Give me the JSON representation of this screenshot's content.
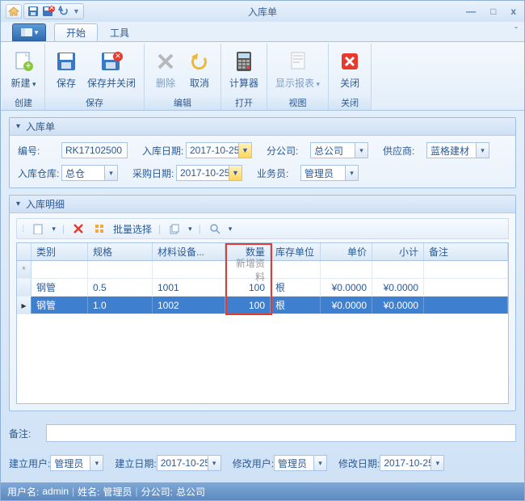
{
  "window": {
    "title": "入库单"
  },
  "ribbon_tabs": {
    "start": "开始",
    "tools": "工具"
  },
  "ribbon": {
    "new": "新建",
    "save": "保存",
    "save_close": "保存并关闭",
    "delete": "删除",
    "cancel": "取消",
    "calculator": "计算器",
    "show_report": "显示报表",
    "close": "关闭",
    "group_create": "创建",
    "group_save": "保存",
    "group_edit": "编辑",
    "group_open": "打开",
    "group_view": "视图",
    "group_close": "关闭"
  },
  "form": {
    "panel_title": "入库单",
    "no_label": "编号:",
    "no_value": "RK17102500",
    "in_date_label": "入库日期:",
    "in_date_value": "2017-10-25",
    "branch_label": "分公司:",
    "branch_value": "总公司",
    "supplier_label": "供应商:",
    "supplier_value": "蓝格建材",
    "warehouse_label": "入库仓库:",
    "warehouse_value": "总仓",
    "purchase_date_label": "采购日期:",
    "purchase_date_value": "2017-10-25",
    "clerk_label": "业务员:",
    "clerk_value": "管理员"
  },
  "detail": {
    "panel_title": "入库明细",
    "batch_select": "批量选择",
    "new_row_text": "新增资料",
    "columns": {
      "category": "类别",
      "spec": "规格",
      "material": "材料设备...",
      "qty": "数量",
      "unit": "库存单位",
      "price": "单价",
      "subtotal": "小计",
      "remark": "备注"
    },
    "rows": [
      {
        "category": "钢管",
        "spec": "0.5",
        "material": "1001",
        "qty": "100",
        "unit": "根",
        "price": "¥0.0000",
        "subtotal": "¥0.0000",
        "remark": ""
      },
      {
        "category": "钢管",
        "spec": "1.0",
        "material": "1002",
        "qty": "100",
        "unit": "根",
        "price": "¥0.0000",
        "subtotal": "¥0.0000",
        "remark": ""
      }
    ]
  },
  "footer": {
    "remark_label": "备注:",
    "create_user_label": "建立用户:",
    "create_user_value": "管理员",
    "create_date_label": "建立日期:",
    "create_date_value": "2017-10-25",
    "modify_user_label": "修改用户:",
    "modify_user_value": "管理员",
    "modify_date_label": "修改日期:",
    "modify_date_value": "2017-10-25"
  },
  "status": {
    "username_label": "用户名:",
    "username": "admin",
    "name_label": "姓名:",
    "name": "管理员",
    "branch_label": "分公司:",
    "branch": "总公司"
  }
}
